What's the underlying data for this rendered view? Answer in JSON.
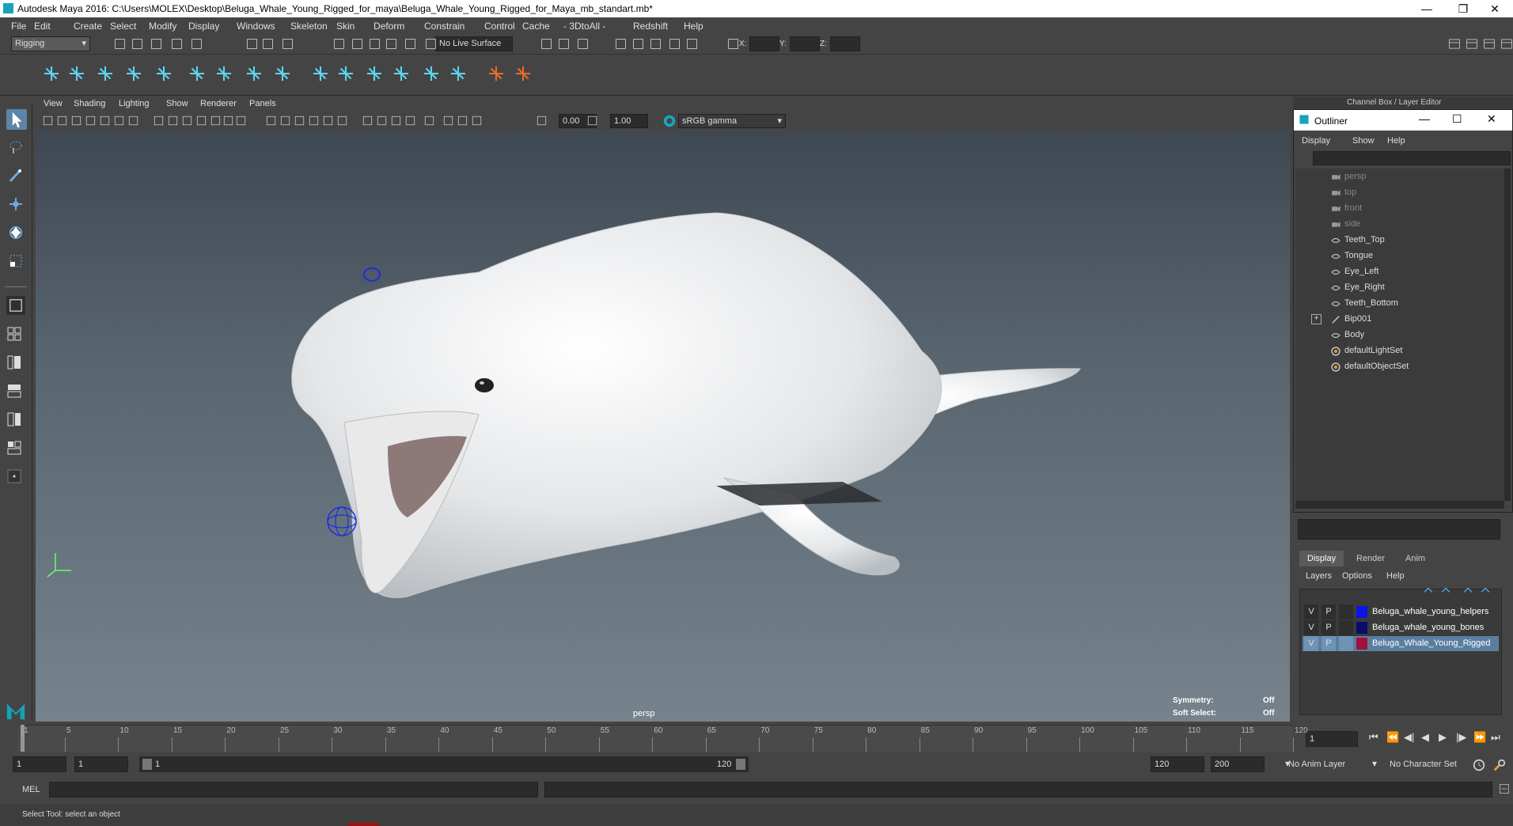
{
  "window": {
    "title": "Autodesk Maya 2016: C:\\Users\\MOLEX\\Desktop\\Beluga_Whale_Young_Rigged_for_maya\\Beluga_Whale_Young_Rigged_for_Maya_mb_standart.mb*"
  },
  "menu": [
    "File",
    "Edit",
    "Create",
    "Select",
    "Modify",
    "Display",
    "Windows",
    "Skeleton",
    "Skin",
    "Deform",
    "Constrain",
    "Control",
    "Cache",
    "- 3DtoAll -",
    "Redshift",
    "Help"
  ],
  "status": {
    "mode": "Rigging",
    "live_surface": "No Live Surface",
    "x_label": "X:",
    "y_label": "Y:",
    "z_label": "Z:"
  },
  "viewport": {
    "menu": [
      "View",
      "Shading",
      "Lighting",
      "Show",
      "Renderer",
      "Panels"
    ],
    "exposure": "0.00",
    "gamma": "1.00",
    "colorspace": "sRGB gamma",
    "camera_label": "persp",
    "symmetry_label": "Symmetry:",
    "symmetry_value": "Off",
    "softselect_label": "Soft Select:",
    "softselect_value": "Off"
  },
  "right_panel": {
    "title": "Channel Box / Layer Editor"
  },
  "outliner": {
    "title": "Outliner",
    "menu": [
      "Display",
      "Show",
      "Help"
    ],
    "items": [
      {
        "label": "persp",
        "type": "camera"
      },
      {
        "label": "top",
        "type": "camera"
      },
      {
        "label": "front",
        "type": "camera"
      },
      {
        "label": "side",
        "type": "camera"
      },
      {
        "label": "Teeth_Top",
        "type": "mesh"
      },
      {
        "label": "Tongue",
        "type": "mesh"
      },
      {
        "label": "Eye_Left",
        "type": "mesh"
      },
      {
        "label": "Eye_Right",
        "type": "mesh"
      },
      {
        "label": "Teeth_Bottom",
        "type": "mesh"
      },
      {
        "label": "Bip001",
        "type": "joint"
      },
      {
        "label": "Body",
        "type": "mesh"
      },
      {
        "label": "defaultLightSet",
        "type": "set"
      },
      {
        "label": "defaultObjectSet",
        "type": "set"
      }
    ]
  },
  "layer_editor": {
    "tabs": [
      "Display",
      "Render",
      "Anim"
    ],
    "menu": [
      "Layers",
      "Options",
      "Help"
    ],
    "layers": [
      {
        "v": "V",
        "p": "P",
        "name": "Beluga_whale_young_helpers",
        "color": "#0a14e6"
      },
      {
        "v": "V",
        "p": "P",
        "name": "Beluga_whale_young_bones",
        "color": "#0b0b6e"
      },
      {
        "v": "V",
        "p": "P",
        "name": "Beluga_Whale_Young_Rigged",
        "color": "#a0103a"
      }
    ]
  },
  "timeline": {
    "ticks": [
      "1",
      "5",
      "10",
      "15",
      "20",
      "25",
      "30",
      "35",
      "40",
      "45",
      "50",
      "55",
      "60",
      "65",
      "70",
      "75",
      "80",
      "85",
      "90",
      "95",
      "100",
      "105",
      "110",
      "115",
      "120"
    ],
    "current_frame": "1"
  },
  "range": {
    "start": "1",
    "playback_start": "1",
    "slider_start": "1",
    "slider_end": "120",
    "playback_end": "120",
    "end": "200",
    "anim_layer": "No Anim Layer",
    "character_set": "No Character Set"
  },
  "command": {
    "label": "MEL"
  },
  "help": {
    "text": "Select Tool: select an object"
  }
}
